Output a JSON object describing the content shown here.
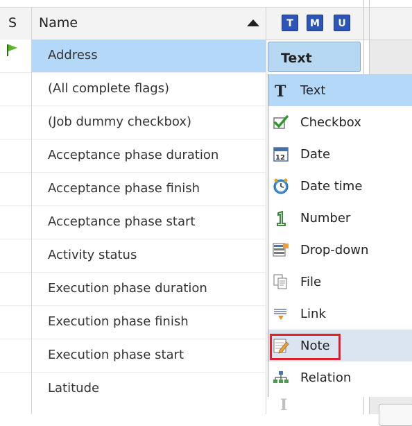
{
  "header": {
    "status_col": "S",
    "name_col": "Name",
    "type_buttons": [
      "T",
      "M",
      "U"
    ]
  },
  "rows": [
    {
      "label": "Address",
      "selected": true,
      "flag": true
    },
    {
      "label": "(All complete flags)"
    },
    {
      "label": "(Job dummy checkbox)"
    },
    {
      "label": "Acceptance phase duration"
    },
    {
      "label": "Acceptance phase finish"
    },
    {
      "label": "Acceptance phase start"
    },
    {
      "label": "Activity status"
    },
    {
      "label": "Execution phase duration"
    },
    {
      "label": "Execution phase finish"
    },
    {
      "label": "Execution phase start"
    },
    {
      "label": "Latitude"
    }
  ],
  "type_dropdown": {
    "current": "Text",
    "items": [
      {
        "label": "Text",
        "icon": "text-icon",
        "state": "hover"
      },
      {
        "label": "Checkbox",
        "icon": "checkbox-icon"
      },
      {
        "label": "Date",
        "icon": "calendar-icon"
      },
      {
        "label": "Date time",
        "icon": "clock-icon"
      },
      {
        "label": "Number",
        "icon": "number-icon"
      },
      {
        "label": "Drop-down",
        "icon": "dropdown-icon"
      },
      {
        "label": "File",
        "icon": "file-icon"
      },
      {
        "label": "Link",
        "icon": "link-icon"
      },
      {
        "label": "Note",
        "icon": "note-icon",
        "state": "highlighted"
      },
      {
        "label": "Relation",
        "icon": "relation-icon"
      }
    ]
  },
  "colors": {
    "selection": "#b4d8f8",
    "highlight_box": "#e0202a",
    "tmu_button": "#2c55b8"
  }
}
